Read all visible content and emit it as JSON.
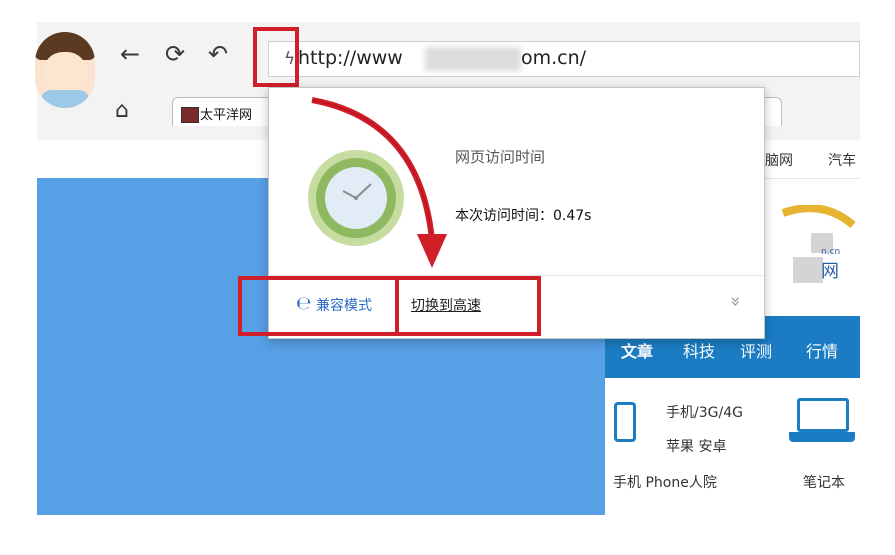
{
  "browser": {
    "back_icon": "←",
    "refresh_icon": "⟳",
    "undo_icon": "↶",
    "home_icon": "⌂",
    "bolt_icon": "ϟ",
    "url_prefix": "http://www",
    "url_suffix": "om.cn/",
    "tabs": [
      {
        "label": "太平洋网"
      },
      {
        "label": ""
      },
      {
        "label": ""
      }
    ]
  },
  "popup": {
    "title": "网页访问时间",
    "visit_time": "本次访问时间：0.47s",
    "compat_icon": "℮",
    "compat_label": "兼容模式",
    "switch_label": "切换到高速",
    "expand_icon": "»"
  },
  "site": {
    "nav_links": [
      "脑网",
      "汽车"
    ],
    "logo_text": "n.cn",
    "logo_glyph": "网",
    "categories": [
      "文章",
      "科技",
      "评测",
      "行情"
    ],
    "phone_tags": "手机/3G/4G",
    "apple_tags": "苹果 安卓",
    "phone_footer": "手机  Phone人院",
    "notebook_label": "笔记本"
  },
  "colors": {
    "highlight": "#d11f2a",
    "page_blue": "#58a0e6",
    "category_bar": "#1b7cc4",
    "clock_green": "#8fb960"
  }
}
